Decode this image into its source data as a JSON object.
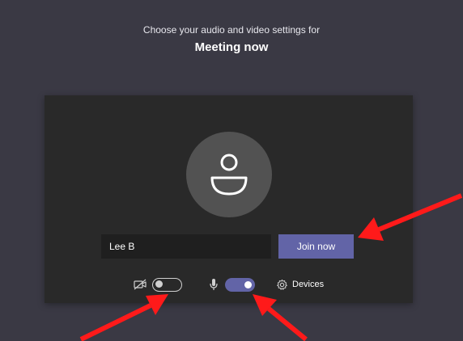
{
  "header": {
    "prompt": "Choose your audio and video settings for",
    "meeting_title": "Meeting now"
  },
  "preview": {
    "avatar_icon": "person-icon"
  },
  "join": {
    "name_value": "Lee B",
    "join_label": "Join now"
  },
  "controls": {
    "camera_icon": "camera-off-icon",
    "camera_on": false,
    "mic_icon": "microphone-icon",
    "mic_on": true,
    "devices_icon": "gear-icon",
    "devices_label": "Devices"
  },
  "annotations": {
    "arrow_color": "#ff1a1a"
  },
  "colors": {
    "background": "#3a3944",
    "card": "#292929",
    "accent": "#6264a7"
  }
}
